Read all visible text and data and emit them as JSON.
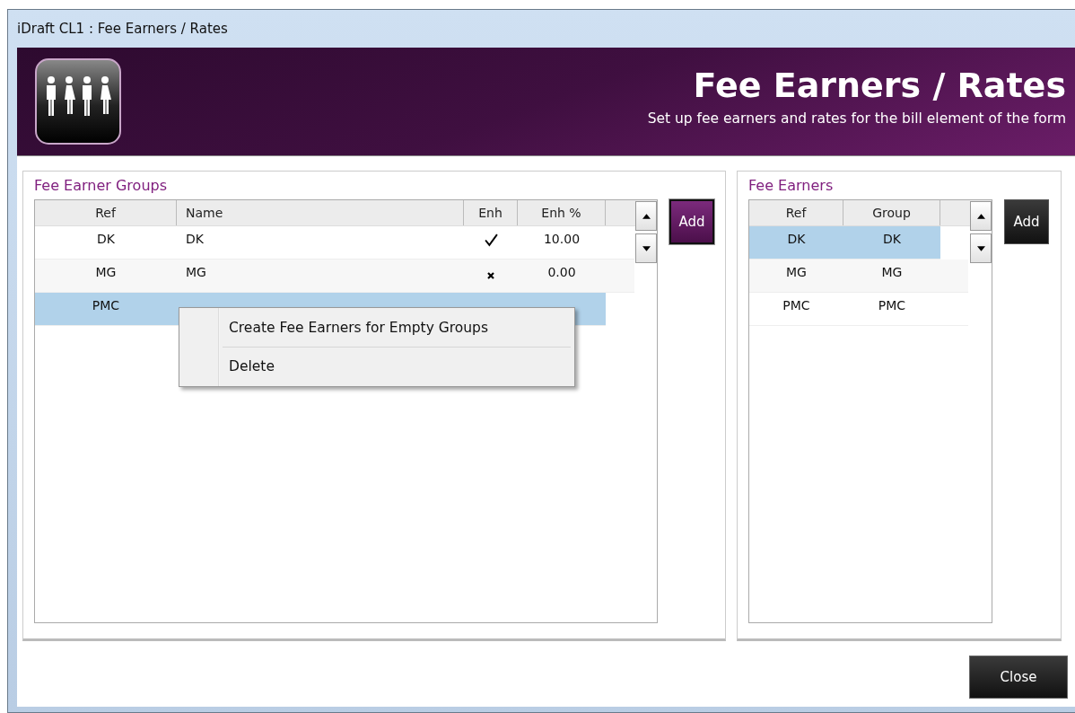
{
  "window": {
    "title": "iDraft CL1 : Fee Earners / Rates"
  },
  "header": {
    "title": "Fee Earners / Rates",
    "subtitle": "Set up fee earners and rates for the bill element of the form"
  },
  "groups": {
    "title": "Fee Earner Groups",
    "columns": [
      "Ref",
      "Name",
      "Enh",
      "Enh %"
    ],
    "rows": [
      {
        "ref": "DK",
        "name": "DK",
        "enhanced": true,
        "enh_pct": "10.00",
        "selected": false
      },
      {
        "ref": "MG",
        "name": "MG",
        "enhanced": false,
        "enh_pct": "0.00",
        "selected": false
      },
      {
        "ref": "PMC",
        "selected": true
      }
    ],
    "add_button": "Add"
  },
  "context_menu": {
    "items": [
      "Create Fee Earners for Empty Groups",
      "Delete"
    ]
  },
  "earners": {
    "title": "Fee Earners",
    "columns": [
      "Ref",
      "Group"
    ],
    "rows": [
      {
        "ref": "DK",
        "group": "DK",
        "selected": true
      },
      {
        "ref": "MG",
        "group": "MG",
        "selected": false
      },
      {
        "ref": "PMC",
        "group": "PMC",
        "selected": false
      }
    ],
    "add_button": "Add"
  },
  "close_button": "Close"
}
